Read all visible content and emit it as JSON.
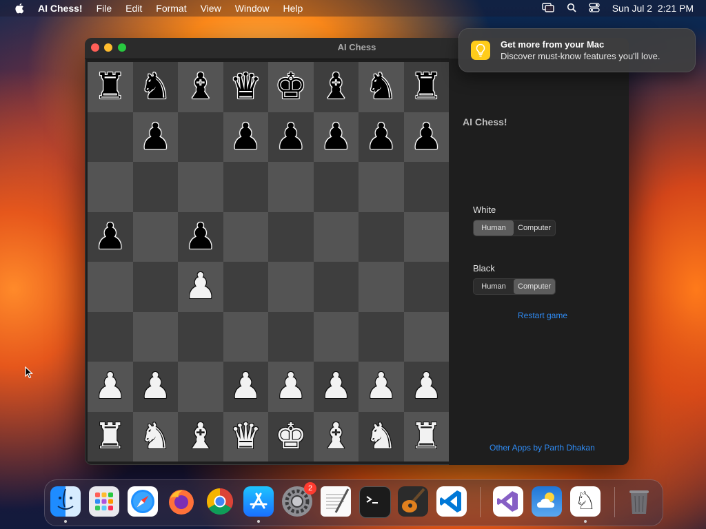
{
  "menubar": {
    "app_name": "AI Chess!",
    "items": [
      "File",
      "Edit",
      "Format",
      "View",
      "Window",
      "Help"
    ],
    "clock": "Sun Jul 2  2:21 PM",
    "icons": [
      "apple-icon",
      "screen-mirroring-icon",
      "spotlight-search-icon",
      "control-center-icon"
    ]
  },
  "window": {
    "title": "AI Chess",
    "board": {
      "rows": [
        [
          "br",
          "bn",
          "bb",
          "bq",
          "bk",
          "bb",
          "bn",
          "br"
        ],
        [
          "",
          "bp",
          "",
          "bp",
          "bp",
          "bp",
          "bp",
          "bp"
        ],
        [
          "",
          "",
          "",
          "",
          "",
          "",
          "",
          ""
        ],
        [
          "bp",
          "",
          "bp",
          "",
          "",
          "",
          "",
          ""
        ],
        [
          "",
          "",
          "wp",
          "",
          "",
          "",
          "",
          ""
        ],
        [
          "",
          "",
          "",
          "",
          "",
          "",
          "",
          ""
        ],
        [
          "wp",
          "wp",
          "",
          "wp",
          "wp",
          "wp",
          "wp",
          "wp"
        ],
        [
          "wr",
          "wn",
          "wb",
          "wq",
          "wk",
          "wb",
          "wn",
          "wr"
        ]
      ],
      "glyphs": {
        "k": "♚",
        "q": "♛",
        "r": "♜",
        "b": "♝",
        "n": "♞",
        "p": "♟"
      }
    },
    "sidebar": {
      "title": "AI Chess!",
      "white": {
        "label": "White",
        "options": [
          "Human",
          "Computer"
        ],
        "selected": "Human"
      },
      "black": {
        "label": "Black",
        "options": [
          "Human",
          "Computer"
        ],
        "selected": "Computer"
      },
      "restart": "Restart game",
      "other_apps": "Other Apps by Parth Dhakan"
    }
  },
  "notification": {
    "title": "Get more from your Mac",
    "subtitle": "Discover must-know features you'll love.",
    "icon": "lightbulb-icon"
  },
  "dock": {
    "apps": [
      {
        "name": "Finder",
        "icon": "finder-icon",
        "running": true
      },
      {
        "name": "Launchpad",
        "icon": "launchpad-icon",
        "running": false
      },
      {
        "name": "Safari",
        "icon": "safari-icon",
        "running": false
      },
      {
        "name": "Firefox",
        "icon": "firefox-icon",
        "running": false
      },
      {
        "name": "Chrome",
        "icon": "chrome-icon",
        "running": false
      },
      {
        "name": "App Store",
        "icon": "app-store-icon",
        "running": true
      },
      {
        "name": "System Settings",
        "icon": "system-settings-icon",
        "running": false,
        "badge": "2"
      },
      {
        "name": "TextEdit",
        "icon": "textedit-icon",
        "running": false
      },
      {
        "name": "Terminal",
        "icon": "terminal-icon",
        "running": false
      },
      {
        "name": "GarageBand",
        "icon": "garageband-icon",
        "running": false
      },
      {
        "name": "VS Code",
        "icon": "vscode-icon",
        "running": false
      },
      {
        "name": "Visual Studio",
        "icon": "visual-studio-icon",
        "running": false
      },
      {
        "name": "Weather",
        "icon": "weather-icon",
        "running": false
      },
      {
        "name": "AI Chess",
        "icon": "chess-knight-icon",
        "running": true
      },
      {
        "name": "Trash",
        "icon": "trash-icon",
        "running": false
      }
    ]
  },
  "colors": {
    "link": "#2f8cf5",
    "light_square": "#545454",
    "dark_square": "#3e3e3e"
  }
}
